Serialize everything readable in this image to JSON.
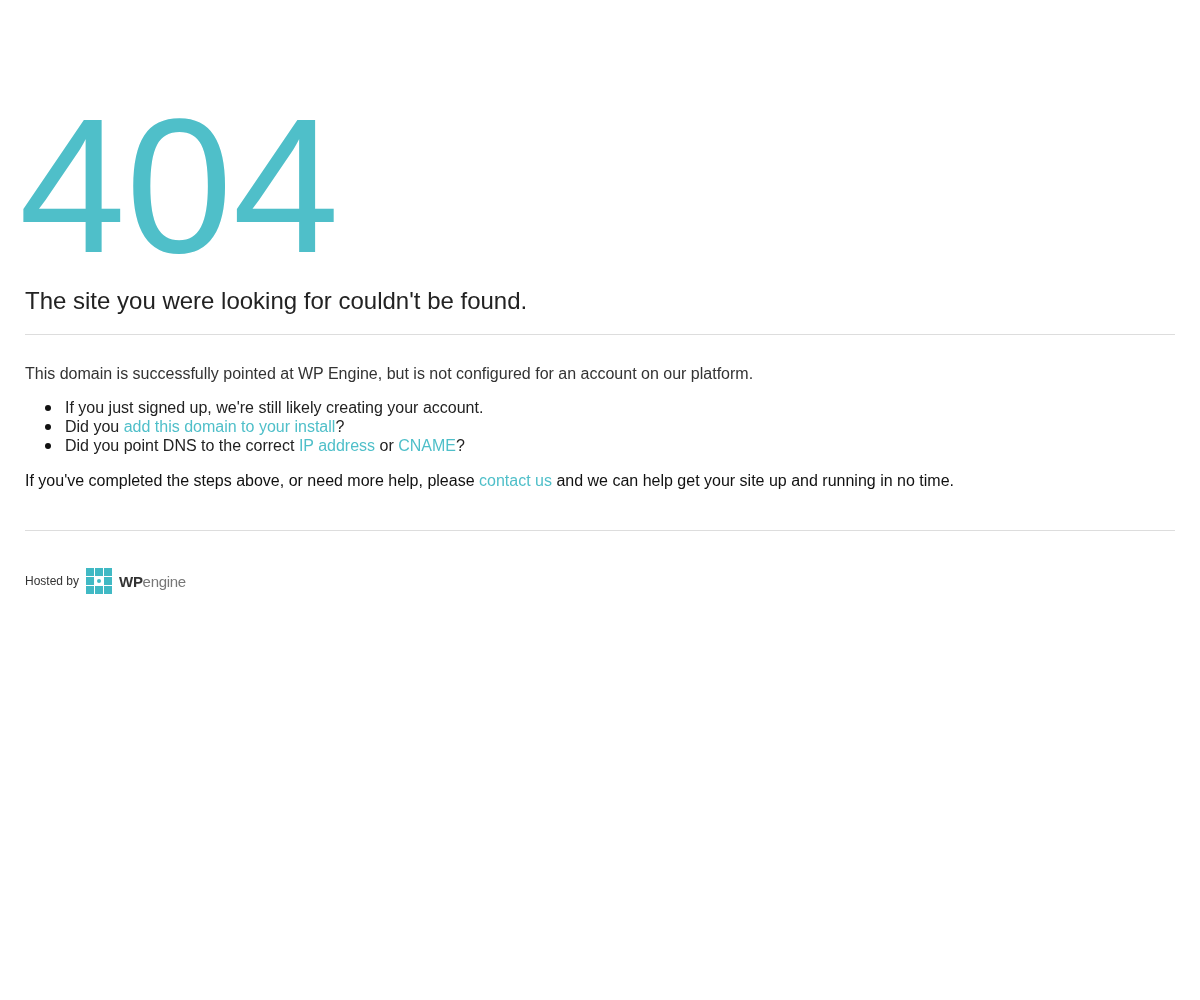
{
  "code": "404",
  "headline": "The site you were looking for couldn't be found.",
  "intro": "This domain is successfully pointed at WP Engine, but is not configured for an account on our platform.",
  "bullets": [
    [
      {
        "kind": "text",
        "text": "If you just signed up, we're still likely creating your account."
      }
    ],
    [
      {
        "kind": "text",
        "text": "Did you "
      },
      {
        "kind": "link",
        "text": "add this domain to your install"
      },
      {
        "kind": "text",
        "text": "?"
      }
    ],
    [
      {
        "kind": "text",
        "text": "Did you point DNS to the correct "
      },
      {
        "kind": "link",
        "text": "IP address"
      },
      {
        "kind": "text",
        "text": " or "
      },
      {
        "kind": "link",
        "text": "CNAME"
      },
      {
        "kind": "text",
        "text": "?"
      }
    ]
  ],
  "help": [
    {
      "kind": "text",
      "text": "If you've completed the steps above, or need more help, please "
    },
    {
      "kind": "link",
      "text": "contact us"
    },
    {
      "kind": "text",
      "text": " and we can help get your site up and running in no time."
    }
  ],
  "footer": {
    "hosted_by": "Hosted by",
    "logo_bold": "WP",
    "logo_rest": "engine"
  }
}
